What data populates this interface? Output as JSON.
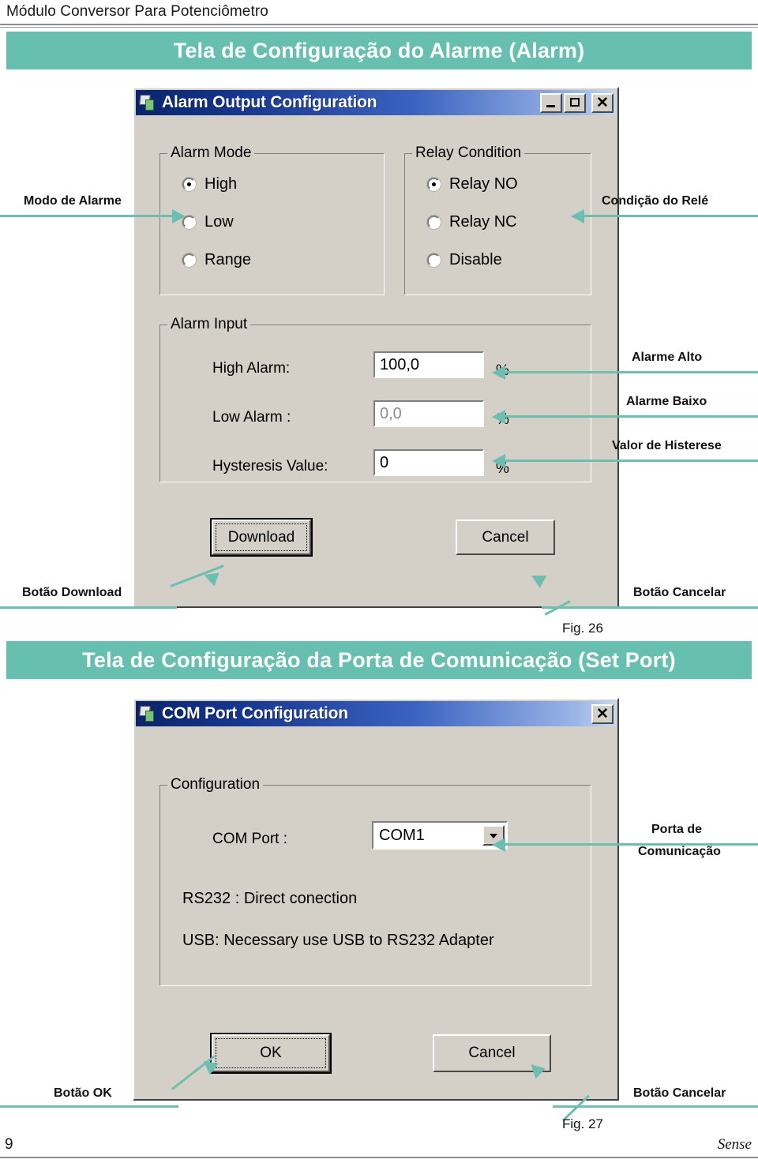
{
  "document": {
    "header_title": "Módulo Conversor Para Potenciômetro",
    "page_number": "9",
    "brand": "Sense"
  },
  "sections": [
    {
      "banner": "Tela de Configuração do Alarme (Alarm)",
      "figure_caption": "Fig. 26"
    },
    {
      "banner": "Tela de Configuração da Porta de Comunicação (Set Port)",
      "figure_caption": "Fig. 27"
    }
  ],
  "alarm_dialog": {
    "title": "Alarm Output Configuration",
    "window_buttons": {
      "minimize": "minimize-icon",
      "maximize": "maximize-icon",
      "close": "close-icon"
    },
    "alarm_mode": {
      "legend": "Alarm Mode",
      "options": [
        {
          "label": "High",
          "selected": true
        },
        {
          "label": "Low",
          "selected": false
        },
        {
          "label": "Range",
          "selected": false
        }
      ]
    },
    "relay_condition": {
      "legend": "Relay Condition",
      "options": [
        {
          "label": "Relay NO",
          "selected": true
        },
        {
          "label": "Relay NC",
          "selected": false
        },
        {
          "label": "Disable",
          "selected": false
        }
      ]
    },
    "alarm_input": {
      "legend": "Alarm Input",
      "fields": [
        {
          "label": "High Alarm:",
          "value": "100,0",
          "unit": "%",
          "disabled": false
        },
        {
          "label": "Low Alarm :",
          "value": "0,0",
          "unit": "%",
          "disabled": true
        },
        {
          "label": "Hysteresis Value:",
          "value": "0",
          "unit": "%",
          "disabled": false
        }
      ]
    },
    "buttons": {
      "download": "Download",
      "cancel": "Cancel"
    },
    "annotations": {
      "alarm_mode": "Modo de Alarme",
      "relay_condition": "Condição do Relé",
      "high_alarm": "Alarme Alto",
      "low_alarm": "Alarme Baixo",
      "hysteresis": "Valor de Histerese",
      "download_button": "Botão Download",
      "cancel_button": "Botão Cancelar"
    }
  },
  "port_dialog": {
    "title": "COM Port Configuration",
    "window_buttons": {
      "close": "close-icon"
    },
    "configuration": {
      "legend": "Configuration",
      "com_port_label": "COM Port :",
      "com_port_value": "COM1",
      "notes": [
        "RS232 : Direct conection",
        "USB: Necessary use USB to RS232 Adapter"
      ]
    },
    "buttons": {
      "ok": "OK",
      "cancel": "Cancel"
    },
    "annotations": {
      "com_port_line1": "Porta de",
      "com_port_line2": "Comunicação",
      "ok_button": "Botão OK",
      "cancel_button": "Botão Cancelar"
    }
  },
  "colors": {
    "banner_teal": "#67bfaf",
    "annotation_teal": "#6cbfb0",
    "dialog_face": "#d4d0c8",
    "titlebar_blue": "#16378f"
  }
}
